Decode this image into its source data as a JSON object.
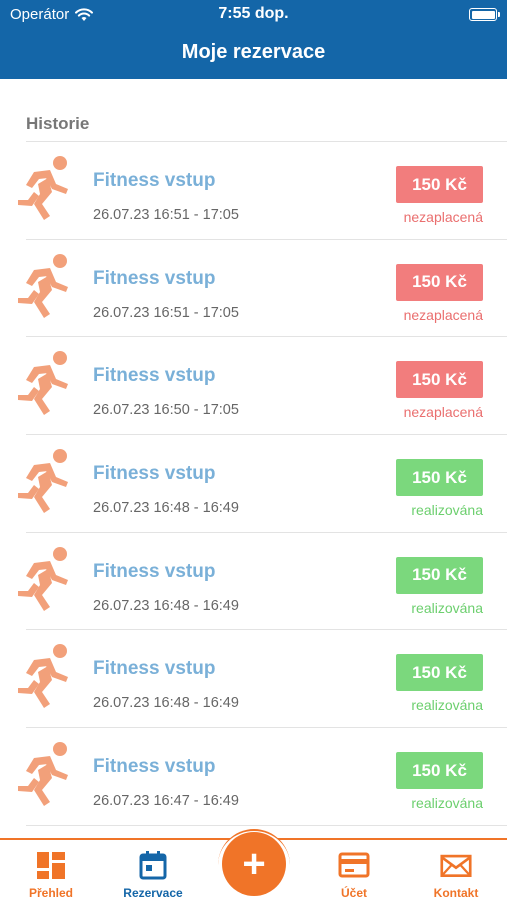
{
  "status": {
    "carrier": "Operátor",
    "time": "7:55 dop."
  },
  "header": {
    "title": "Moje rezervace"
  },
  "section": {
    "title": "Historie"
  },
  "reservations": [
    {
      "title": "Fitness vstup",
      "time": "26.07.23 16:51 - 17:05",
      "price": "150 Kč",
      "state": "nezaplacená",
      "status": "unpaid"
    },
    {
      "title": "Fitness vstup",
      "time": "26.07.23 16:51 - 17:05",
      "price": "150 Kč",
      "state": "nezaplacená",
      "status": "unpaid"
    },
    {
      "title": "Fitness vstup",
      "time": "26.07.23 16:50 - 17:05",
      "price": "150 Kč",
      "state": "nezaplacená",
      "status": "unpaid"
    },
    {
      "title": "Fitness vstup",
      "time": "26.07.23 16:48 - 16:49",
      "price": "150 Kč",
      "state": "realizována",
      "status": "done"
    },
    {
      "title": "Fitness vstup",
      "time": "26.07.23 16:48 - 16:49",
      "price": "150 Kč",
      "state": "realizována",
      "status": "done"
    },
    {
      "title": "Fitness vstup",
      "time": "26.07.23 16:48 - 16:49",
      "price": "150 Kč",
      "state": "realizována",
      "status": "done"
    },
    {
      "title": "Fitness vstup",
      "time": "26.07.23 16:47 - 16:49",
      "price": "150 Kč",
      "state": "realizována",
      "status": "done"
    }
  ],
  "tabbar": {
    "items": [
      {
        "label": "Přehled",
        "icon": "dashboard-icon"
      },
      {
        "label": "Rezervace",
        "icon": "calendar-icon"
      },
      {
        "label": "Účet",
        "icon": "card-icon"
      },
      {
        "label": "Kontakt",
        "icon": "mail-icon"
      }
    ],
    "fab_icon": "plus-icon",
    "fab_label": "+"
  },
  "colors": {
    "primary": "#1466a8",
    "accent": "#f07428",
    "unpaid": "#f27d7d",
    "done": "#7bd87d",
    "runner": "#f2a07a"
  }
}
